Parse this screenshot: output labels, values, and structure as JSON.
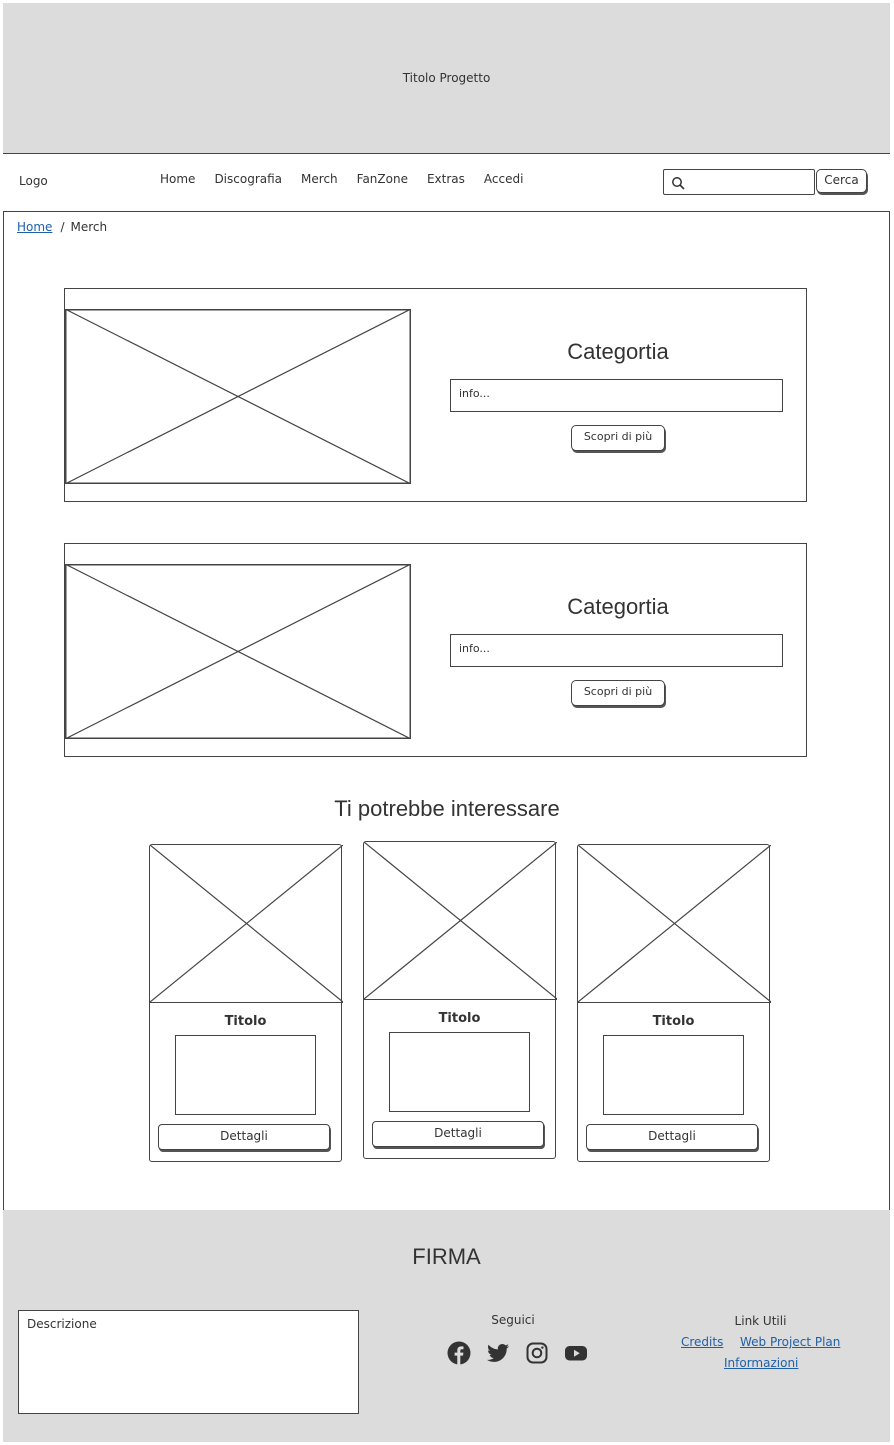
{
  "header": {
    "title": "Titolo Progetto"
  },
  "navbar": {
    "logo": "Logo",
    "links": [
      "Home",
      "Discografia",
      "Merch",
      "FanZone",
      "Extras",
      "Accedi"
    ],
    "search_placeholder": "",
    "search_button": "Cerca"
  },
  "breadcrumb": {
    "home": "Home",
    "current": "Merch"
  },
  "categories": [
    {
      "title": "Categortia",
      "info": "info...",
      "button": "Scopri di più"
    },
    {
      "title": "Categortia",
      "info": "info...",
      "button": "Scopri di più"
    }
  ],
  "suggestions": {
    "title": "Ti potrebbe interessare",
    "cards": [
      {
        "title": "Titolo",
        "button": "Dettagli"
      },
      {
        "title": "Titolo",
        "button": "Dettagli"
      },
      {
        "title": "Titolo",
        "button": "Dettagli"
      }
    ]
  },
  "footer": {
    "signature": "FIRMA",
    "description": "Descrizione",
    "social_title": "Seguici",
    "social_icons": [
      "facebook-icon",
      "twitter-icon",
      "instagram-icon",
      "youtube-icon"
    ],
    "links_title": "Link Utili",
    "links": [
      "Credits",
      "Web Project Plan",
      "Informazioni"
    ]
  },
  "colors": {
    "band": "#dcdcdc",
    "stroke": "#444444",
    "link": "#1f5fa8"
  }
}
